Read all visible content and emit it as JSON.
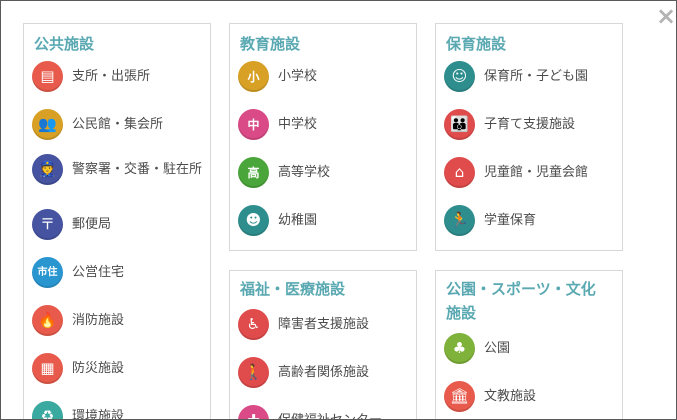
{
  "close_icon": "×",
  "panels": {
    "public": {
      "title": "公共施設",
      "items": [
        {
          "label": "支所・出張所",
          "icon": "town-office-icon",
          "glyph": "▤",
          "color": "#e85b4c"
        },
        {
          "label": "公民館・集会所",
          "icon": "community-hall-icon",
          "glyph": "👥",
          "color": "#d8a126"
        },
        {
          "label": "警察署・交番・駐在所",
          "icon": "police-icon",
          "glyph": "👮",
          "color": "#4553a0"
        },
        {
          "label": "郵便局",
          "icon": "post-office-icon",
          "glyph": "〒",
          "color": "#4553a0"
        },
        {
          "label": "公営住宅",
          "icon": "public-housing-icon",
          "glyph": "市住",
          "color": "#2a96d0"
        },
        {
          "label": "消防施設",
          "icon": "fire-station-icon",
          "glyph": "🔥",
          "color": "#e85b4c"
        },
        {
          "label": "防災施設",
          "icon": "disaster-prevention-icon",
          "glyph": "▦",
          "color": "#e85b4c"
        },
        {
          "label": "環境施設",
          "icon": "environment-icon",
          "glyph": "♻",
          "color": "#3aa9a0"
        }
      ]
    },
    "education": {
      "title": "教育施設",
      "items": [
        {
          "label": "小学校",
          "icon": "elementary-school-icon",
          "glyph": "小",
          "color": "#d8a126"
        },
        {
          "label": "中学校",
          "icon": "junior-high-icon",
          "glyph": "中",
          "color": "#d94a86"
        },
        {
          "label": "高等学校",
          "icon": "high-school-icon",
          "glyph": "高",
          "color": "#4aa63a"
        },
        {
          "label": "幼稚園",
          "icon": "kindergarten-icon",
          "glyph": "☻",
          "color": "#2e8e8e"
        }
      ]
    },
    "childcare": {
      "title": "保育施設",
      "items": [
        {
          "label": "保育所・子ども園",
          "icon": "nursery-icon",
          "glyph": "☺",
          "color": "#2e8e8e"
        },
        {
          "label": "子育て支援施設",
          "icon": "childcare-support-icon",
          "glyph": "👪",
          "color": "#e04b4b"
        },
        {
          "label": "児童館・児童会館",
          "icon": "childrens-hall-icon",
          "glyph": "⌂",
          "color": "#e04b4b"
        },
        {
          "label": "学童保育",
          "icon": "after-school-icon",
          "glyph": "🏃",
          "color": "#2e8e8e"
        }
      ]
    },
    "welfare": {
      "title": "福祉・医療施設",
      "items": [
        {
          "label": "障害者支援施設",
          "icon": "wheelchair-icon",
          "glyph": "♿",
          "color": "#e04b4b"
        },
        {
          "label": "高齢者関係施設",
          "icon": "elderly-icon",
          "glyph": "🚶",
          "color": "#e04b4b"
        },
        {
          "label": "保健福祉センター",
          "icon": "health-center-icon",
          "glyph": "✚",
          "color": "#d94a86"
        }
      ]
    },
    "parks": {
      "title": "公園・スポーツ・文化施設",
      "items": [
        {
          "label": "公園",
          "icon": "park-icon",
          "glyph": "♣",
          "color": "#7fb23a"
        },
        {
          "label": "文教施設",
          "icon": "cultural-facility-icon",
          "glyph": "🏛",
          "color": "#e85b4c"
        }
      ]
    }
  }
}
